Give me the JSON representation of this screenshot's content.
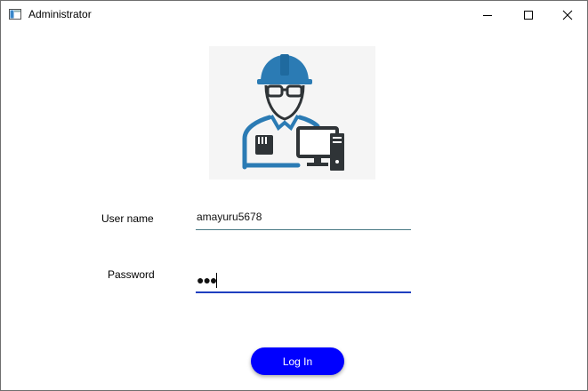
{
  "window": {
    "title": "Administrator"
  },
  "icons": {
    "app": "app-window-icon",
    "minimize": "minimize-icon",
    "maximize": "maximize-icon",
    "close": "close-icon",
    "logo": "engineer-with-computer-icon"
  },
  "form": {
    "username_label": "User name",
    "username_value": "amayuru5678",
    "password_label": "Password",
    "password_masked": "●●●",
    "login_label": "Log In"
  },
  "colors": {
    "accent": "#0000ff",
    "logo_blue": "#2b7bb4",
    "logo_dark": "#2f3437",
    "focus_underline": "#1f3fbf"
  }
}
